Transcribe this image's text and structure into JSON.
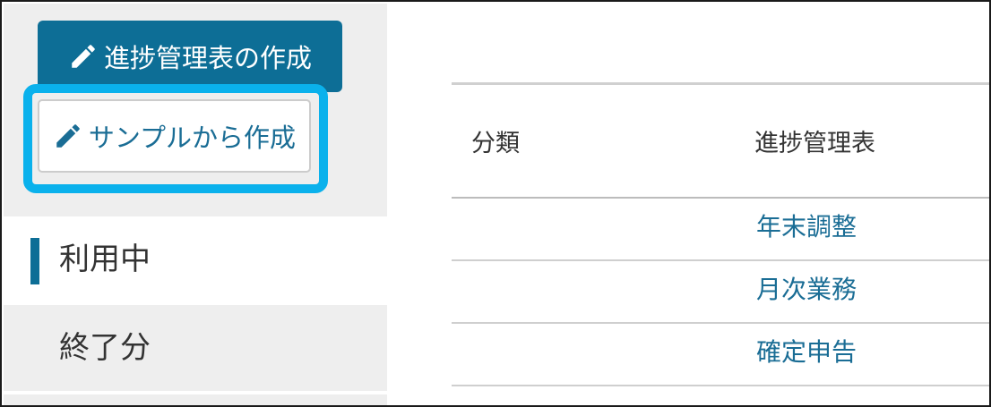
{
  "sidebar": {
    "create_button_label": "進捗管理表の作成",
    "sample_button_label": "サンプルから作成",
    "nav_items": [
      {
        "label": "利用中",
        "active": true
      },
      {
        "label": "終了分",
        "active": false
      }
    ]
  },
  "table": {
    "headers": [
      "分類",
      "進捗管理表"
    ],
    "rows": [
      {
        "category": "",
        "name": "年末調整"
      },
      {
        "category": "",
        "name": "月次業務"
      },
      {
        "category": "",
        "name": "確定申告"
      }
    ]
  },
  "colors": {
    "primary": "#0d6e96",
    "highlight": "#0ab1ec",
    "link": "#1a6d95",
    "sidebar_bg": "#eeeeee"
  },
  "icons": {
    "create": "pencil-icon",
    "sample": "pencil-icon"
  }
}
